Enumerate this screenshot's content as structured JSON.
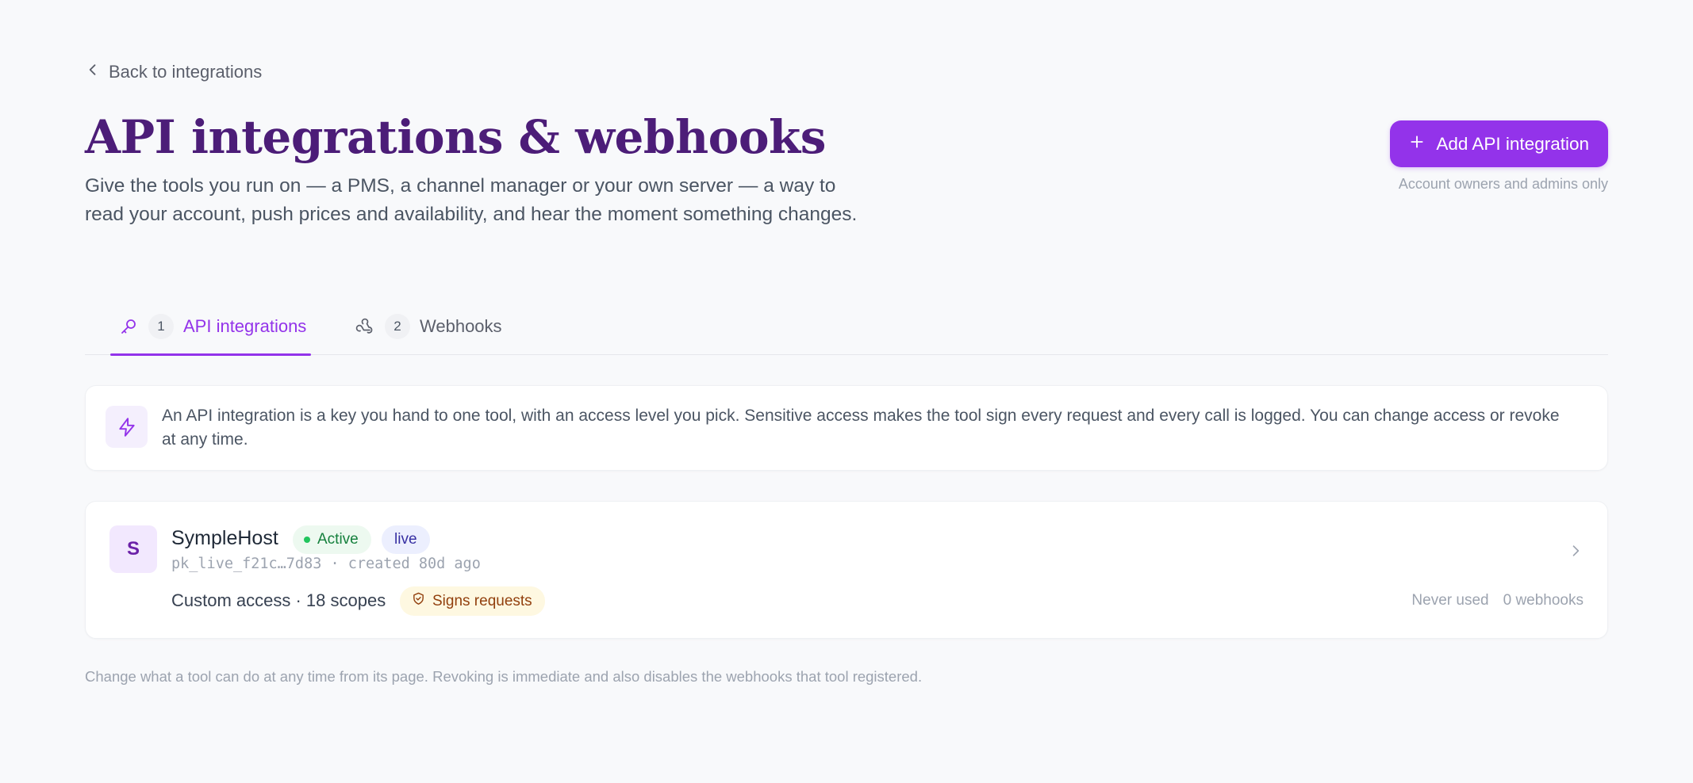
{
  "nav": {
    "back_label": "Back to integrations"
  },
  "header": {
    "title": "API integrations & webhooks",
    "subtitle": "Give the tools you run on — a PMS, a channel manager or your own server — a way to read your account, push prices and availability, and hear the moment something changes.",
    "add_button_label": "Add API integration",
    "add_button_note": "Account owners and admins only"
  },
  "tabs": [
    {
      "label": "API integrations",
      "count": "1",
      "icon": "key-icon",
      "active": true
    },
    {
      "label": "Webhooks",
      "count": "2",
      "icon": "webhook-icon",
      "active": false
    }
  ],
  "info": {
    "icon": "lightning-icon",
    "text": "An API integration is a key you hand to one tool, with an access level you pick. Sensitive access makes the tool sign every request and every call is logged. You can change access or revoke at any time."
  },
  "integrations": [
    {
      "initial": "S",
      "name": "SympleHost",
      "status": "Active",
      "environment": "live",
      "key_info": "pk_live_f21c…7d83 · created 80d ago",
      "access": "Custom access · 18 scopes",
      "signing_badge": "Signs requests",
      "last_used": "Never used",
      "webhooks": "0 webhooks"
    }
  ],
  "footnote": "Change what a tool can do at any time from its page. Revoking is immediate and also disables the webhooks that tool registered.",
  "colors": {
    "accent": "#9333ea",
    "title": "#4c1d78",
    "background": "#f8f9fb",
    "status_active": "#22c55e"
  }
}
